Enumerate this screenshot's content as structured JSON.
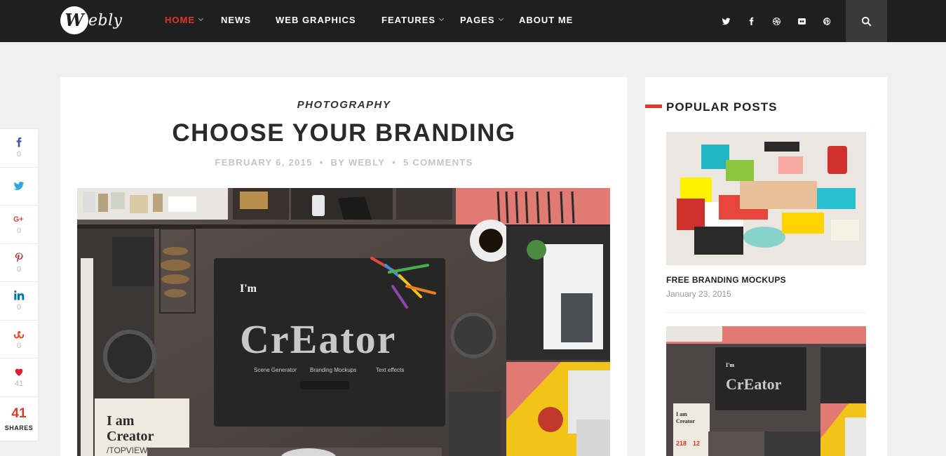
{
  "brand": {
    "logo_initial": "W",
    "logo_rest": "ebly"
  },
  "nav": {
    "items": [
      {
        "label": "HOME",
        "active": true,
        "dropdown": true
      },
      {
        "label": "NEWS",
        "active": false,
        "dropdown": false
      },
      {
        "label": "WEB GRAPHICS",
        "active": false,
        "dropdown": false
      },
      {
        "label": "FEATURES",
        "active": false,
        "dropdown": true
      },
      {
        "label": "PAGES",
        "active": false,
        "dropdown": true
      },
      {
        "label": "ABOUT ME",
        "active": false,
        "dropdown": false
      }
    ],
    "social_icons": [
      "twitter-icon",
      "facebook-icon",
      "dribbble-icon",
      "flickr-icon",
      "pinterest-icon"
    ],
    "search_icon": "search-icon"
  },
  "share": {
    "items": [
      {
        "icon": "facebook-icon",
        "count": "0"
      },
      {
        "icon": "twitter-icon",
        "count": ""
      },
      {
        "icon": "google-plus-icon",
        "count": "0"
      },
      {
        "icon": "pinterest-icon",
        "count": "0"
      },
      {
        "icon": "linkedin-icon",
        "count": "0"
      },
      {
        "icon": "stumbleupon-icon",
        "count": "0"
      },
      {
        "icon": "heart-icon",
        "count": "41"
      }
    ],
    "total": "41",
    "total_label": "SHARES"
  },
  "post": {
    "category": "PHOTOGRAPHY",
    "title": "CHOOSE YOUR BRANDING",
    "date": "FEBRUARY 6, 2015",
    "author": "BY WEBLY",
    "comments": "5 COMMENTS",
    "hero": {
      "im": "I'm",
      "creator": "CrEator",
      "tags": [
        "Scene Generator",
        "Branding Mockups",
        "Text effects"
      ],
      "card_line1": "I am",
      "card_line2": "Creator",
      "card_line3": "/TOPVIEW"
    }
  },
  "sidebar": {
    "title": "POPULAR POSTS",
    "posts": [
      {
        "title": "FREE BRANDING MOCKUPS",
        "date": "January 23, 2015"
      }
    ]
  },
  "colors": {
    "accent": "#e0372a",
    "nav_bg": "#1f1f1f",
    "page_bg": "#f0f0f0"
  }
}
